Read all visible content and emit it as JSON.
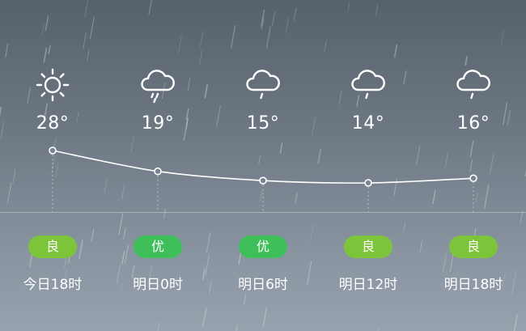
{
  "forecast": [
    {
      "time": "今日18时",
      "temp": "28°",
      "icon": "sunny-icon",
      "aqi": "良",
      "aqi_color": "#7cc53a"
    },
    {
      "time": "明日0时",
      "temp": "19°",
      "icon": "rain-cloud-icon",
      "aqi": "优",
      "aqi_color": "#3fbf5a"
    },
    {
      "time": "明日6时",
      "temp": "15°",
      "icon": "light-rain-cloud-icon",
      "aqi": "优",
      "aqi_color": "#3fbf5a"
    },
    {
      "time": "明日12时",
      "temp": "14°",
      "icon": "light-rain-cloud-icon",
      "aqi": "良",
      "aqi_color": "#7cc53a"
    },
    {
      "time": "明日18时",
      "temp": "16°",
      "icon": "light-rain-cloud-icon",
      "aqi": "良",
      "aqi_color": "#7cc53a"
    }
  ],
  "chart_data": {
    "type": "line",
    "categories": [
      "今日18时",
      "明日0时",
      "明日6时",
      "明日12时",
      "明日18时"
    ],
    "series": [
      {
        "values": [
          28,
          19,
          15,
          14,
          16
        ]
      }
    ],
    "grid": false
  }
}
